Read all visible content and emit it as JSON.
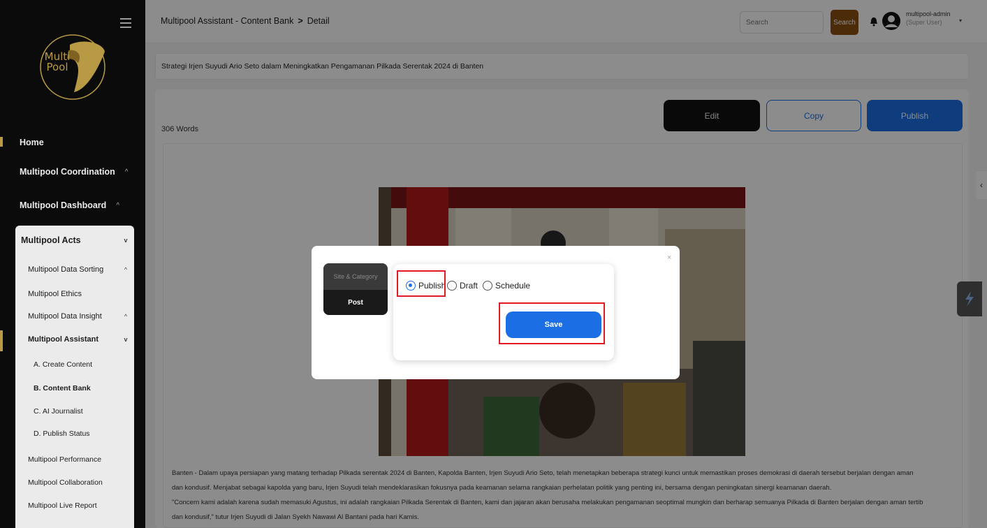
{
  "sidebar": {
    "logo_text_line1": "Multi",
    "logo_text_line2": "Pool",
    "top_items": [
      {
        "label": "Home"
      },
      {
        "label": "Multipool Coordination",
        "chevron": "^"
      },
      {
        "label": "Multipool Dashboard",
        "chevron": "^"
      }
    ],
    "acts": {
      "label": "Multipool Acts",
      "chevron": "v",
      "items": [
        {
          "label": "Multipool Data Sorting",
          "chevron": "^"
        },
        {
          "label": "Multipool Ethics",
          "chevron": ""
        },
        {
          "label": "Multipool Data Insight",
          "chevron": "^"
        },
        {
          "label": "Multipool Assistant",
          "chevron": "v"
        }
      ],
      "sub_items": [
        {
          "label": "A. Create Content"
        },
        {
          "label": "B. Content Bank"
        },
        {
          "label": "C. AI Journalist"
        },
        {
          "label": "D. Publish Status"
        }
      ],
      "bottom_items": [
        {
          "label": "Multipool Performance"
        },
        {
          "label": "Multipool Collaboration"
        },
        {
          "label": "Multipool Live Report"
        }
      ]
    }
  },
  "header": {
    "breadcrumb_parent": "Multipool Assistant - Content Bank",
    "breadcrumb_sep": ">",
    "breadcrumb_current": "Detail",
    "search_placeholder": "Search",
    "search_button": "Search",
    "user_name": "multipool-admin",
    "user_role": "(Super User)"
  },
  "main": {
    "article_title": "Strategi Irjen Suyudi Ario Seto dalam Meningkatkan Pengamanan Pilkada Serentak 2024 di Banten",
    "word_count": "306 Words",
    "actions": {
      "edit": "Edit",
      "copy": "Copy",
      "publish": "Publish"
    },
    "paragraphs": [
      "Banten - Dalam upaya persiapan yang matang terhadap Pilkada serentak 2024 di Banten, Kapolda Banten, Irjen Suyudi Ario Seto, telah menetapkan beberapa strategi kunci untuk memastikan proses demokrasi di daerah tersebut berjalan dengan aman",
      "dan kondusif. Menjabat sebagai kapolda yang baru, Irjen Suyudi telah mendeklarasikan fokusnya pada keamanan selama rangkaian perhelatan politik yang penting ini, bersama dengan peningkatan sinergi keamanan daerah.",
      "\"Concern kami adalah karena sudah memasuki Agustus, ini adalah rangkaian Pilkada Serentak di Banten, kami dan jajaran akan berusaha melakukan pengamanan seoptimal mungkin dan berharap semuanya Pilkada di Banten berjalan dengan aman tertib",
      "dan kondusif,\" tutur Irjen Suyudi di Jalan Syekh Nawawi Al Bantani pada hari Kamis."
    ]
  },
  "modal": {
    "close": "×",
    "tabs": {
      "site_category": "Site & Category",
      "post": "Post"
    },
    "options": [
      {
        "label": "Publish",
        "checked": true
      },
      {
        "label": "Draft",
        "checked": false
      },
      {
        "label": "Schedule",
        "checked": false
      }
    ],
    "save": "Save"
  },
  "colors": {
    "accent_blue": "#1b6ee3",
    "brand_gold": "#c8a84a",
    "search_brown": "#8a4f12",
    "highlight_red": "#e01b24"
  }
}
